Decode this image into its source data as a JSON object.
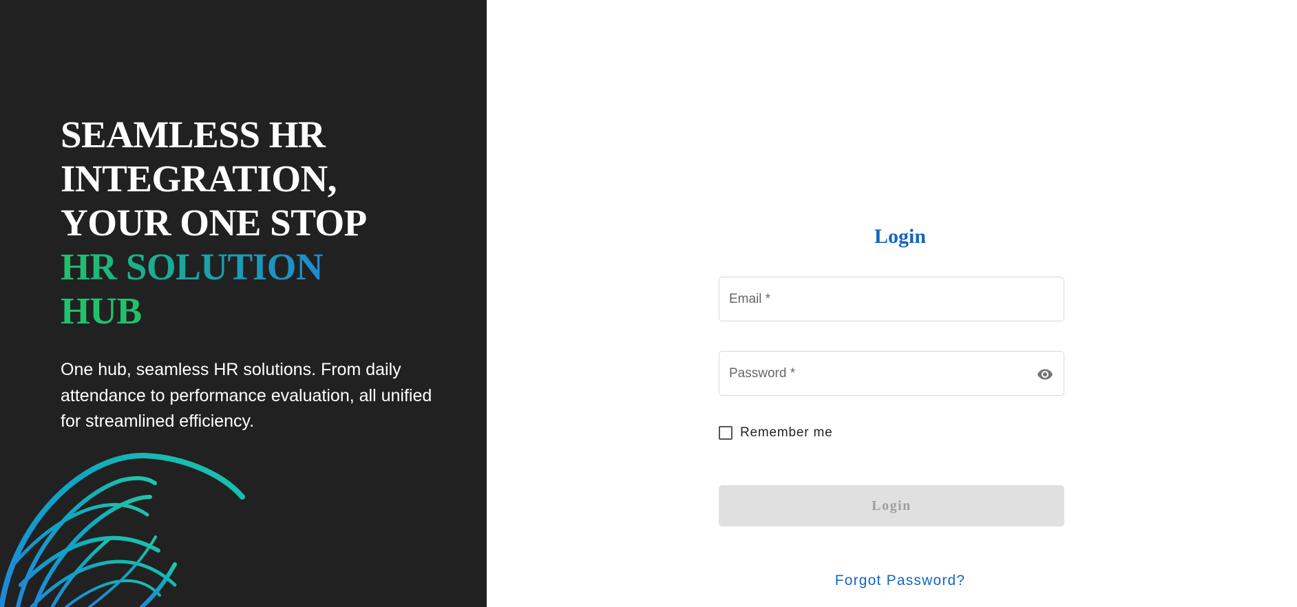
{
  "hero": {
    "title_lines": [
      "SEAMLESS HR",
      "INTEGRATION,",
      "YOUR ONE STOP"
    ],
    "title_highlight_lines": [
      "HR SOLUTION",
      "HUB"
    ],
    "description": "One hub, seamless HR solutions. From daily attendance to performance evaluation, all unified for streamlined efficiency.",
    "globe_icon": "globe-icon"
  },
  "login": {
    "title": "Login",
    "email_placeholder": "Email *",
    "email_value": "",
    "password_placeholder": "Password *",
    "password_value": "",
    "password_toggle_icon": "eye-icon",
    "remember_label": "Remember me",
    "remember_checked": false,
    "submit_label": "Login",
    "forgot_label": "Forgot Password?"
  },
  "colors": {
    "hero_background": "#212121",
    "accent_blue": "#1565c0",
    "highlight_green": "#21c16b",
    "highlight_blue": "#1e88d8",
    "button_disabled_bg": "#e0e0e0",
    "button_disabled_text": "#9e9e9e"
  }
}
